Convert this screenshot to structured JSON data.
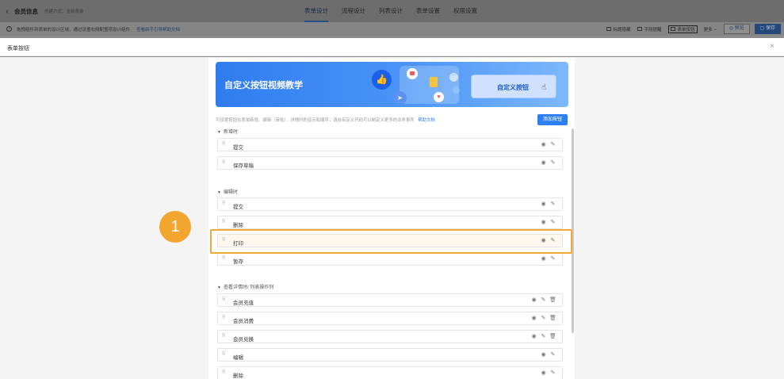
{
  "topbar": {
    "back_icon": "chevron-left-icon",
    "title": "会员信息",
    "subtitle": "创建方式：全新表单",
    "tabs": [
      {
        "label": "表单设计",
        "active": true
      },
      {
        "label": "流程设计",
        "active": false
      },
      {
        "label": "列表设计",
        "active": false
      },
      {
        "label": "表单设置",
        "active": false
      },
      {
        "label": "权限设置",
        "active": false
      }
    ]
  },
  "infobar": {
    "tip": "拖拽组件到表单的设计区域，通过设置右侧配置项设计组件",
    "tip_link": "查看新手引导帮助文档",
    "tools": [
      "标题隐藏",
      "字段提醒",
      "表单按钮",
      "更多"
    ],
    "preview_label": "预览",
    "save_label": "保存"
  },
  "drawer": {
    "title": "表单按钮",
    "close_icon": "close-icon"
  },
  "banner": {
    "title": "自定义按钮视频教学",
    "button_label": "自定义按钮"
  },
  "description": {
    "text": "可设置按钮在表单新增、编辑（审批）、详情时的显示和顺序，请自有定义代码可以制定义更多的业务事件",
    "help_link": "帮助文档"
  },
  "add_button_label": "添加按钮",
  "sections": [
    {
      "title": "新增时",
      "rows": [
        {
          "label": "提交",
          "actions": [
            "eye-icon",
            "edit-icon"
          ]
        },
        {
          "label": "保存草稿",
          "actions": [
            "eye-icon",
            "edit-icon"
          ]
        }
      ]
    },
    {
      "title": "编辑时",
      "rows": [
        {
          "label": "提交",
          "actions": [
            "eye-icon",
            "edit-icon"
          ]
        },
        {
          "label": "删除",
          "actions": [
            "eye-icon",
            "edit-icon"
          ]
        },
        {
          "label": "打印",
          "actions": [
            "eye-icon",
            "edit-icon"
          ]
        },
        {
          "label": "暂存",
          "actions": [
            "eye-icon",
            "edit-icon"
          ]
        }
      ]
    },
    {
      "title": "查看详情时/ 列表操作列",
      "rows": [
        {
          "label": "会员充值",
          "actions": [
            "eye-icon",
            "edit-icon",
            "trash-icon"
          ]
        },
        {
          "label": "会员消费",
          "actions": [
            "eye-icon",
            "edit-icon",
            "trash-icon"
          ]
        },
        {
          "label": "会员兑换",
          "actions": [
            "eye-icon",
            "edit-icon",
            "trash-icon"
          ]
        },
        {
          "label": "编辑",
          "actions": [
            "eye-icon",
            "edit-icon"
          ]
        },
        {
          "label": "删除",
          "actions": [
            "eye-icon",
            "edit-icon"
          ]
        }
      ]
    }
  ],
  "callout": {
    "number": "1",
    "color": "#f2a630"
  },
  "colors": {
    "accent": "#2e7ff2",
    "highlight": "#f2a732"
  }
}
